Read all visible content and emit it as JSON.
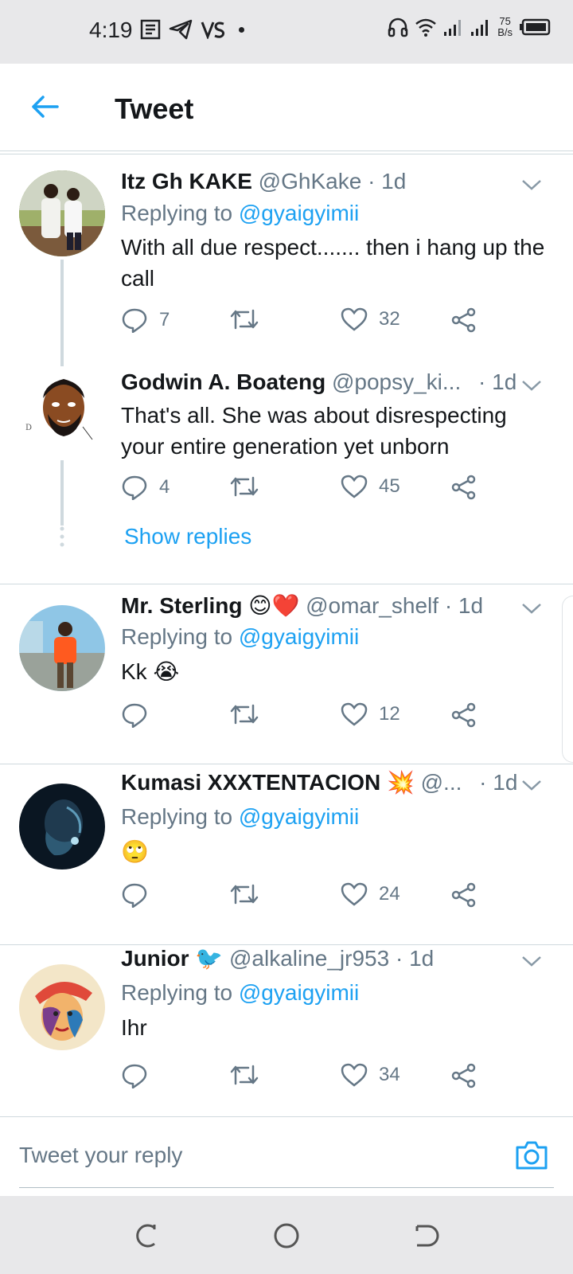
{
  "status_bar": {
    "time": "4:19",
    "speed_value": "75",
    "speed_unit": "B/s",
    "icons": [
      "article-icon",
      "telegram-icon",
      "vs-icon",
      "headphones-icon",
      "wifi-icon",
      "signal-icon",
      "signal-icon",
      "battery-icon"
    ]
  },
  "header": {
    "title": "Tweet"
  },
  "tweets": [
    {
      "name": "Itz Gh KAKE",
      "handle": "@GhKake",
      "time": "· 1d",
      "replying_label": "Replying to",
      "replying_to": "@gyaigyimii",
      "text": "With all due respect....... then i hang up the call",
      "replies": "7",
      "retweets": "",
      "likes": "32"
    },
    {
      "name": "Godwin A. Boateng",
      "handle": "@popsy_ki...",
      "time": "· 1d",
      "text": "That's all. She was about disrespecting your entire generation yet unborn",
      "replies": "4",
      "retweets": "",
      "likes": "45"
    },
    {
      "name": "Mr. Sterling 😊❤️",
      "handle": "@omar_shelf",
      "time": "· 1d",
      "replying_label": "Replying to",
      "replying_to": "@gyaigyimii",
      "text": "Kk 😭",
      "replies": "",
      "retweets": "",
      "likes": "12"
    },
    {
      "name": "Kumasi XXXTENTACION 💥",
      "handle": "@...",
      "time": "· 1d",
      "replying_label": "Replying to",
      "replying_to": "@gyaigyimii",
      "text": "🙄",
      "replies": "",
      "retweets": "",
      "likes": "24"
    },
    {
      "name": "Junior 🐦",
      "handle": "@alkaline_jr953",
      "time": "· 1d",
      "replying_label": "Replying to",
      "replying_to": "@gyaigyimii",
      "text": "Ihr",
      "replies": "",
      "retweets": "",
      "likes": "34"
    }
  ],
  "show_replies": "Show replies",
  "reply_bar": {
    "placeholder": "Tweet your reply"
  },
  "colors": {
    "accent": "#1da1f2",
    "secondary_text": "#657786",
    "divider": "#cfd9de"
  }
}
